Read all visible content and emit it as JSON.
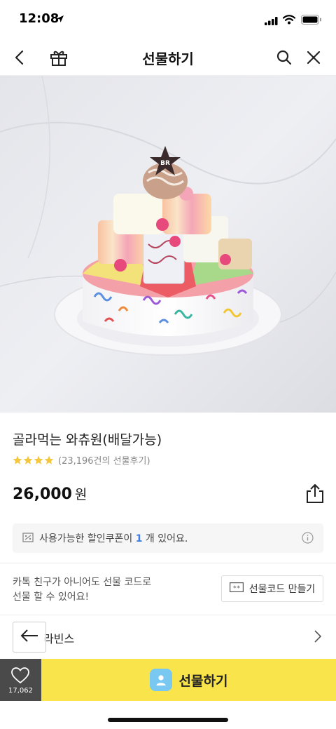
{
  "status_bar": {
    "time": "12:08"
  },
  "nav": {
    "title": "선물하기"
  },
  "product": {
    "title": "골라먹는 와츄원(배달가능)",
    "rating_stars": 4,
    "review_count_text": "(23,196건의 선물후기)",
    "price": "26,000",
    "price_unit": "원",
    "image_brand_mark": "BR"
  },
  "coupon": {
    "text_before": "사용가능한 할인쿠폰이 ",
    "count": "1",
    "text_after": " 개 있어요."
  },
  "giftcode": {
    "line1": "카톡 친구가 아니어도 선물 코드로",
    "line2": "선물 할 수 있어요!",
    "button_label": "선물코드 만들기",
    "button_icon_text": "**"
  },
  "brand": {
    "name": "라빈스"
  },
  "bottom_bar": {
    "like_count": "17,062",
    "gift_label": "선물하기"
  },
  "colors": {
    "accent_yellow": "#fae44c",
    "star_color": "#f4c63d",
    "coupon_count_blue": "#3d7fe0",
    "like_bg": "#4a4a4a",
    "avatar_blue": "#79c8f2"
  }
}
